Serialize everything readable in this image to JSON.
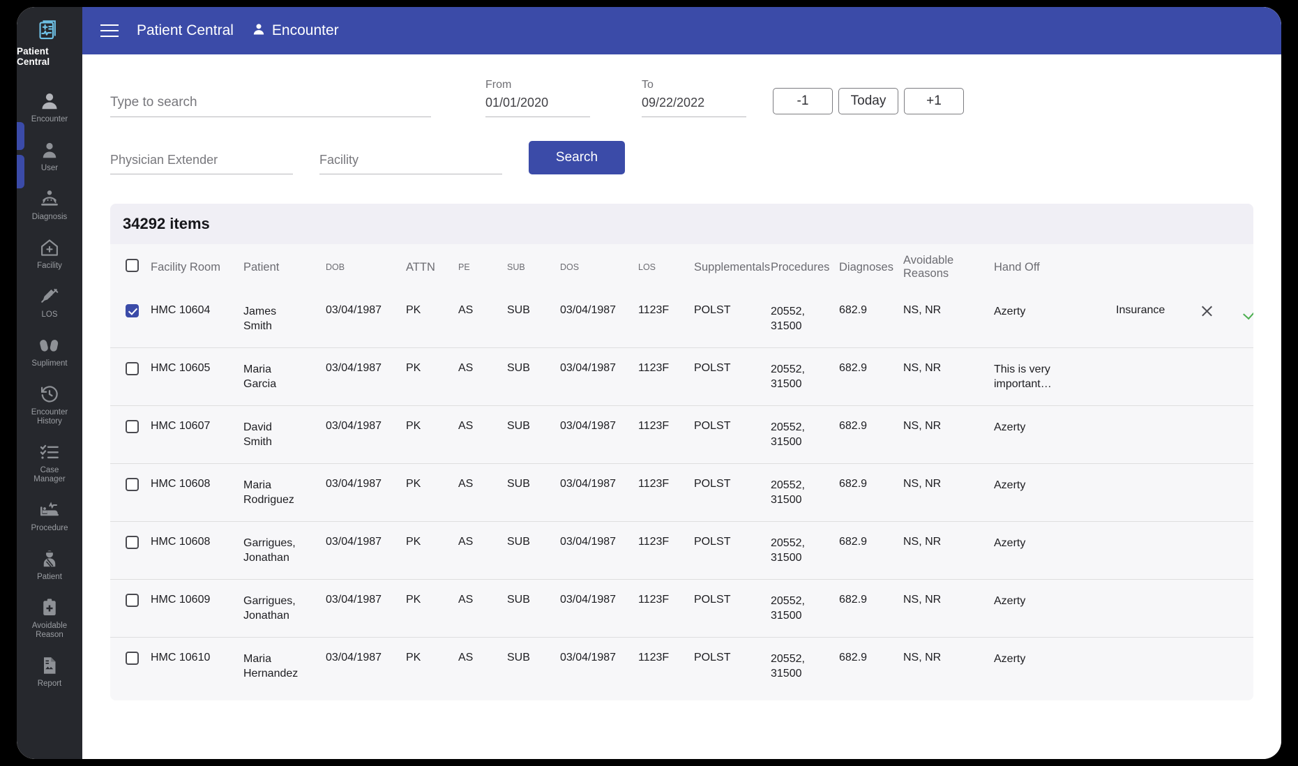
{
  "sidebar": {
    "brand": {
      "label": "Patient Central",
      "icon": "medical-record-icon"
    },
    "items": [
      {
        "label": "Encounter",
        "icon": "person-icon",
        "name": "encounter"
      },
      {
        "label": "User",
        "icon": "user-icon",
        "name": "user"
      },
      {
        "label": "Diagnosis",
        "icon": "patient-bed-icon",
        "name": "diagnosis"
      },
      {
        "label": "Facility",
        "icon": "hospital-home-icon",
        "name": "facility"
      },
      {
        "label": "LOS",
        "icon": "syringe-icon",
        "name": "los"
      },
      {
        "label": "Supliment",
        "icon": "pills-icon",
        "name": "supliment"
      },
      {
        "label": "Encounter\nHistory",
        "icon": "clock-history-icon",
        "name": "encounter-history"
      },
      {
        "label": "Case\nManager",
        "icon": "checklist-icon",
        "name": "case-manager"
      },
      {
        "label": "Procedure",
        "icon": "hospital-bed-monitor-icon",
        "name": "procedure"
      },
      {
        "label": "Patient",
        "icon": "injured-patient-icon",
        "name": "patient"
      },
      {
        "label": "Avoidable\nReason",
        "icon": "clipboard-plus-icon",
        "name": "avoidable-reason"
      },
      {
        "label": "Report",
        "icon": "report-document-icon",
        "name": "report"
      }
    ]
  },
  "topbar": {
    "app_title": "Patient Central",
    "section_label": "Encounter",
    "menu_icon": "hamburger-icon",
    "section_icon": "person-icon",
    "background_color": "#3b4ba8"
  },
  "search": {
    "query_placeholder": "Type to search",
    "query_value": "",
    "from_label": "From",
    "from_value": "01/01/2020",
    "to_label": "To",
    "to_value": "09/22/2022",
    "physician_extender_placeholder": "Physician Extender",
    "physician_extender_value": "",
    "facility_placeholder": "Facility",
    "facility_value": "",
    "search_button": "Search",
    "day_nav": {
      "prev": "-1",
      "today": "Today",
      "next": "+1"
    }
  },
  "results": {
    "count_label": "34292 items",
    "columns": [
      {
        "label": "Facility Room",
        "size": "lg"
      },
      {
        "label": "Patient",
        "size": "lg"
      },
      {
        "label": "DOB",
        "size": "sm"
      },
      {
        "label": "ATTN",
        "size": "lg"
      },
      {
        "label": "PE",
        "size": "sm"
      },
      {
        "label": "SUB",
        "size": "sm"
      },
      {
        "label": "DOS",
        "size": "sm"
      },
      {
        "label": "LOS",
        "size": "sm"
      },
      {
        "label": "Supplementals",
        "size": "lg"
      },
      {
        "label": "Procedures",
        "size": "lg"
      },
      {
        "label": "Diagnoses",
        "size": "lg"
      },
      {
        "label": "Avoidable Reasons",
        "size": "lg"
      },
      {
        "label": "Hand Off",
        "size": "lg"
      }
    ],
    "rows": [
      {
        "selected": true,
        "facility_room": "HMC 10604",
        "patient": "James\nSmith",
        "dob": "03/04/1987",
        "attn": "PK",
        "pe": "AS",
        "sub": "SUB",
        "dos": "03/04/1987",
        "los": "1123F",
        "supplementals": "POLST",
        "procedures": "20552,\n31500",
        "diagnoses": "682.9",
        "avoidable_reasons": "NS, NR",
        "hand_off": "Azerty",
        "action_label": "Insurance",
        "show_actions": true
      },
      {
        "selected": false,
        "facility_room": "HMC 10605",
        "patient": "Maria\nGarcia",
        "dob": "03/04/1987",
        "attn": "PK",
        "pe": "AS",
        "sub": "SUB",
        "dos": "03/04/1987",
        "los": "1123F",
        "supplementals": "POLST",
        "procedures": "20552,\n31500",
        "diagnoses": "682.9",
        "avoidable_reasons": "NS, NR",
        "hand_off": "This is very\nimportant…",
        "action_label": "",
        "show_actions": false
      },
      {
        "selected": false,
        "facility_room": "HMC 10607",
        "patient": "David\nSmith",
        "dob": "03/04/1987",
        "attn": "PK",
        "pe": "AS",
        "sub": "SUB",
        "dos": "03/04/1987",
        "los": "1123F",
        "supplementals": "POLST",
        "procedures": "20552,\n31500",
        "diagnoses": "682.9",
        "avoidable_reasons": "NS, NR",
        "hand_off": "Azerty",
        "action_label": "",
        "show_actions": false
      },
      {
        "selected": false,
        "facility_room": "HMC 10608",
        "patient": "Maria\nRodriguez",
        "dob": "03/04/1987",
        "attn": "PK",
        "pe": "AS",
        "sub": "SUB",
        "dos": "03/04/1987",
        "los": "1123F",
        "supplementals": "POLST",
        "procedures": "20552,\n31500",
        "diagnoses": "682.9",
        "avoidable_reasons": "NS, NR",
        "hand_off": "Azerty",
        "action_label": "",
        "show_actions": false
      },
      {
        "selected": false,
        "facility_room": "HMC 10608",
        "patient": "Garrigues,\nJonathan",
        "dob": "03/04/1987",
        "attn": "PK",
        "pe": "AS",
        "sub": "SUB",
        "dos": "03/04/1987",
        "los": "1123F",
        "supplementals": "POLST",
        "procedures": "20552,\n31500",
        "diagnoses": "682.9",
        "avoidable_reasons": "NS, NR",
        "hand_off": "Azerty",
        "action_label": "",
        "show_actions": false
      },
      {
        "selected": false,
        "facility_room": "HMC 10609",
        "patient": "Garrigues,\nJonathan",
        "dob": "03/04/1987",
        "attn": "PK",
        "pe": "AS",
        "sub": "SUB",
        "dos": "03/04/1987",
        "los": "1123F",
        "supplementals": "POLST",
        "procedures": "20552,\n31500",
        "diagnoses": "682.9",
        "avoidable_reasons": "NS, NR",
        "hand_off": "Azerty",
        "action_label": "",
        "show_actions": false
      },
      {
        "selected": false,
        "facility_room": "HMC 10610",
        "patient": "Maria\nHernandez",
        "dob": "03/04/1987",
        "attn": "PK",
        "pe": "AS",
        "sub": "SUB",
        "dos": "03/04/1987",
        "los": "1123F",
        "supplementals": "POLST",
        "procedures": "20552,\n31500",
        "diagnoses": "682.9",
        "avoidable_reasons": "NS, NR",
        "hand_off": "Azerty",
        "action_label": "",
        "show_actions": false
      }
    ],
    "action_icons": {
      "dismiss": "close-x-icon",
      "confirm": "check-icon"
    },
    "confirm_color": "#4caf50"
  }
}
